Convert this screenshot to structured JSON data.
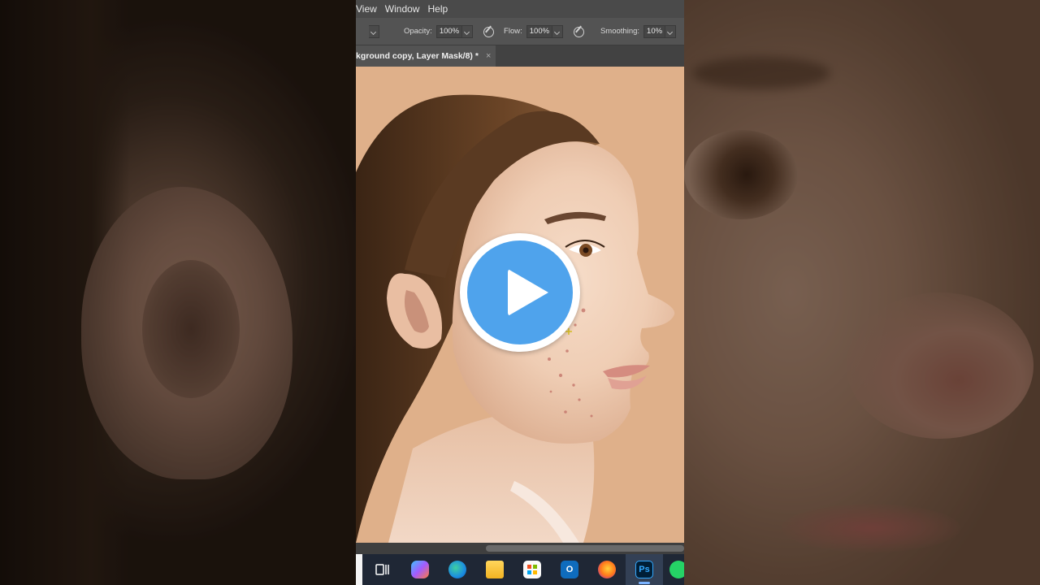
{
  "menubar": {
    "items": [
      "View",
      "Window",
      "Help"
    ]
  },
  "options_bar": {
    "opacity_label": "Opacity:",
    "opacity_value": "100%",
    "flow_label": "Flow:",
    "flow_value": "100%",
    "smoothing_label": "Smoothing:",
    "smoothing_value": "10%"
  },
  "document_tab": {
    "label": "kground copy, Layer Mask/8) *",
    "close": "×"
  },
  "taskbar": {
    "apps": [
      "task-view-icon",
      "copilot-icon",
      "edge-icon",
      "file-explorer-icon",
      "microsoft-store-icon",
      "outlook-icon",
      "firefox-icon",
      "photoshop-icon",
      "whatsapp-icon"
    ],
    "photoshop_label": "Ps",
    "outlook_label": "O"
  },
  "colors": {
    "canvas_background": "#dfb08a",
    "play_button": "#4fa3ec",
    "ps_panel": "#535353",
    "taskbar": "#1f2735"
  }
}
